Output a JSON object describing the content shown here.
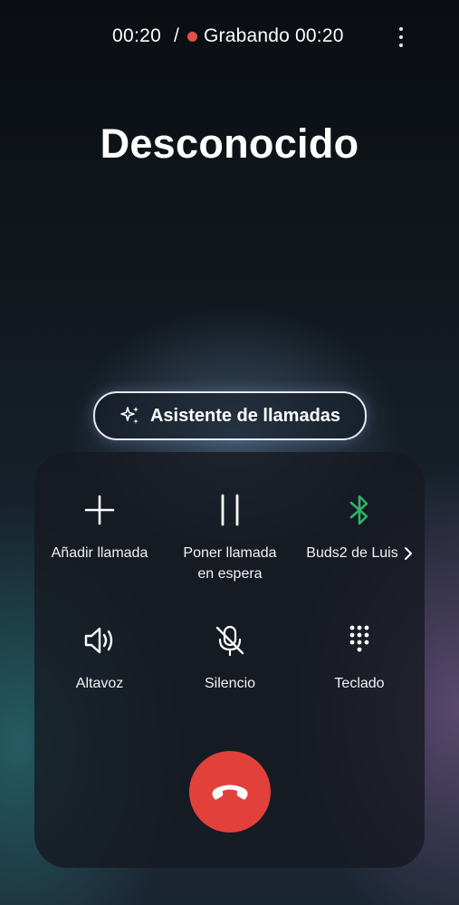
{
  "status": {
    "elapsed_time": "00:20",
    "separator": "/",
    "recording_label": "Grabando 00:20",
    "recording_color": "#e0534a"
  },
  "caller": {
    "name": "Desconocido"
  },
  "assistant": {
    "label": "Asistente de llamadas"
  },
  "controls": {
    "add_call": "Añadir llamada",
    "hold_line1": "Poner llamada",
    "hold_line2": "en espera",
    "bluetooth_device": "Buds2 de Luis",
    "speaker": "Altavoz",
    "mute": "Silencio",
    "keypad": "Teclado"
  },
  "icons": {
    "add": "plus-icon",
    "hold": "pause-icon",
    "bluetooth": "bluetooth-icon",
    "speaker": "speaker-icon",
    "mute": "mic-off-icon",
    "keypad": "keypad-icon",
    "end_call": "phone-hangup-icon",
    "more": "more-vertical-icon",
    "assistant": "sparkle-icon"
  },
  "colors": {
    "end_call": "#e2413b",
    "bluetooth_active": "#2fb36a"
  }
}
